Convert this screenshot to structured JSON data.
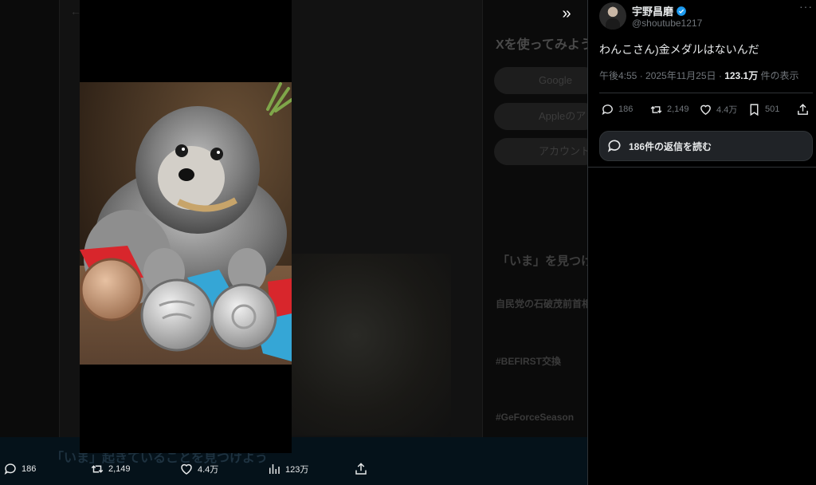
{
  "background": {
    "promo_title": "Xを使ってみよう",
    "pill_google": "Google",
    "pill_apple": "Appleのアカウント",
    "pill_account": "アカウント",
    "trends_heading": "「いま」を見つけよう",
    "trend_1": "自民党の石破茂前首相",
    "trend_2": "#BEFIRST交換",
    "trend_3": "#GeForceSeason",
    "bottom_ghost": "「いま」起きていることを見つけよう"
  },
  "media_actions": {
    "reply_count": "186",
    "retweet_count": "2,149",
    "like_count": "4.4万",
    "views_count": "123万"
  },
  "tweet": {
    "display_name": "宇野昌磨",
    "handle": "@shoutube1217",
    "text": "わんこさん)金メダルはないんだ",
    "time": "午後4:55 · 2025年11月25日 · ",
    "views": "123.1万",
    "views_suffix": " 件の表示",
    "reply_count": "186",
    "retweet_count": "2,149",
    "like_count": "4.4万",
    "bookmark_count": "501",
    "read_replies_label": "186件の返信を読む"
  },
  "colors": {
    "background": "#000000",
    "text_primary": "#e7e9ea",
    "text_secondary": "#71767b",
    "border": "#2f3336",
    "verified_blue": "#1d9bf0"
  },
  "icons": [
    "chevron-double-right-icon",
    "reply-icon",
    "retweet-icon",
    "like-icon",
    "bookmark-icon",
    "views-icon",
    "share-icon",
    "more-icon",
    "verified-icon",
    "chat-bubble-icon"
  ]
}
